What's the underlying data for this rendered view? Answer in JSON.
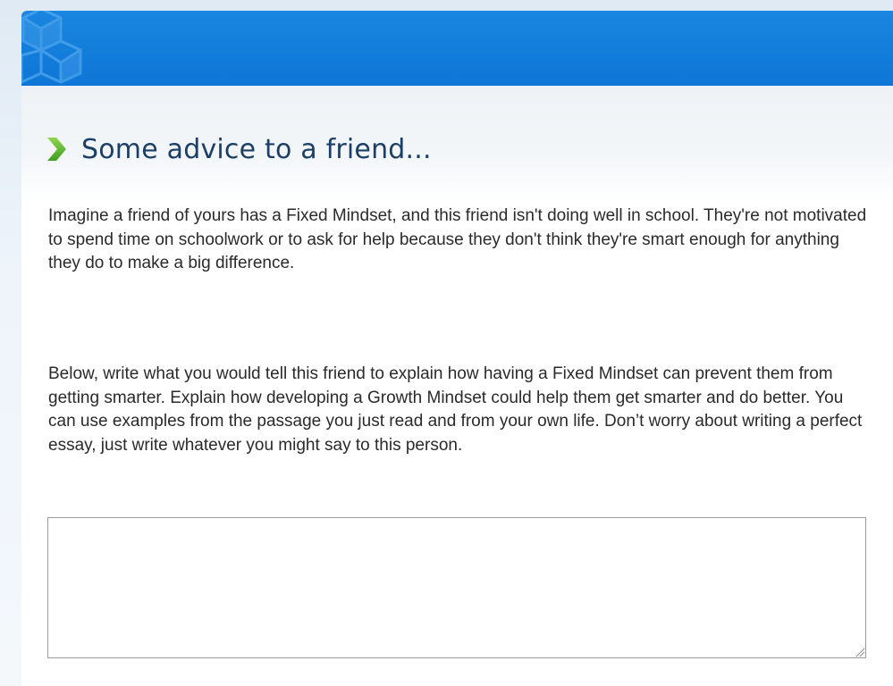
{
  "header": {
    "logo_icon": "cube-logo-icon",
    "bar_color": "#0e76d6"
  },
  "section": {
    "title_icon": "green-chevron-icon",
    "title": "Some advice to a friend...",
    "paragraphs": [
      "Imagine a friend of yours has a Fixed Mindset, and this friend isn't doing well in school. They're not motivated to spend time on schoolwork or to ask for help because they don't think they're smart enough for anything they do to make a big difference.",
      "Below, write what you would tell this friend to explain how having a Fixed Mindset can prevent them from getting smarter. Explain how developing a Growth Mindset could help them get smarter and do better. You can use examples from the passage you just read and from your own life. Don’t worry about writing a perfect essay, just write whatever you might say to this person."
    ]
  },
  "response": {
    "value": "",
    "placeholder": ""
  },
  "colors": {
    "accent_green": "#5cb82e",
    "title_color": "#1b3f66"
  }
}
